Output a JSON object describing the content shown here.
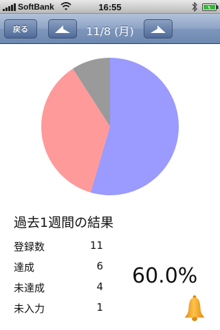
{
  "status_bar": {
    "carrier": "SoftBank",
    "time": "16:55",
    "icons": [
      "signal-icon",
      "wifi-icon",
      "bluetooth-icon",
      "battery-icon"
    ]
  },
  "nav": {
    "back_label": "戻る",
    "title": "11/8 (月)",
    "prev_icon": "left-arrow-icon",
    "next_icon": "right-arrow-icon"
  },
  "summary": {
    "title": "過去1週間の結果",
    "rows": [
      {
        "label": "登録数",
        "value": "11"
      },
      {
        "label": "達成",
        "value": "6"
      },
      {
        "label": "未達成",
        "value": "4"
      },
      {
        "label": "未入力",
        "value": "1"
      }
    ],
    "percent": "60.0%",
    "bell_icon": "bell-icon",
    "bell_color": "#f5a623"
  },
  "chart_data": {
    "type": "pie",
    "slices": [
      {
        "category": "達成",
        "value": 6,
        "color": "#9a9aff"
      },
      {
        "category": "未達成",
        "value": 4,
        "color": "#ff9a9a"
      },
      {
        "category": "未入力",
        "value": 1,
        "color": "#9a9a9a"
      }
    ]
  }
}
